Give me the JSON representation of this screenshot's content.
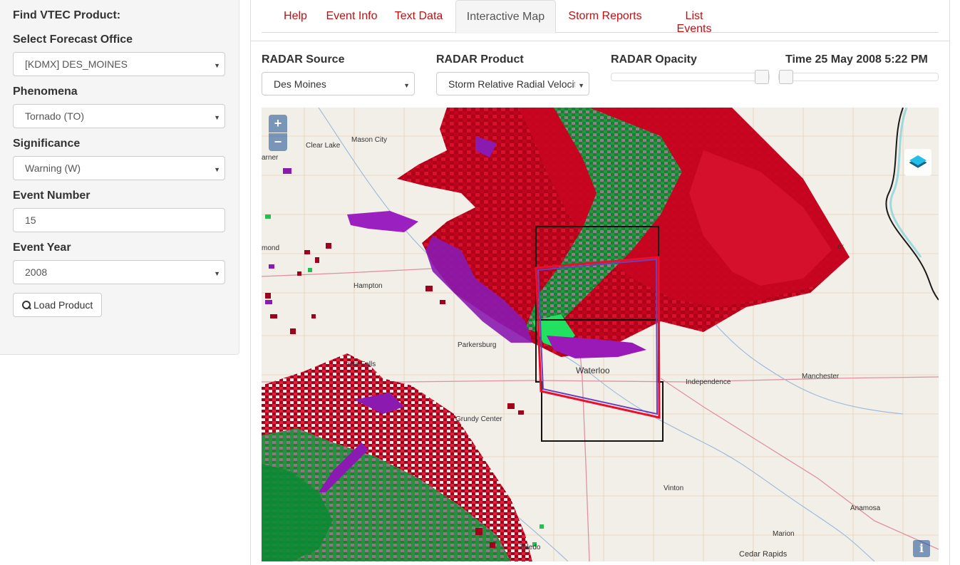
{
  "sidebar": {
    "title": "Find VTEC Product:",
    "office_label": "Select Forecast Office",
    "office_value": "[KDMX] DES_MOINES",
    "phenomena_label": "Phenomena",
    "phenomena_value": "Tornado (TO)",
    "significance_label": "Significance",
    "significance_value": "Warning (W)",
    "event_number_label": "Event Number",
    "event_number_value": "15",
    "event_year_label": "Event Year",
    "event_year_value": "2008",
    "load_button": "Load Product"
  },
  "tabs": [
    {
      "label": "Help",
      "active": false
    },
    {
      "label": "Event Info",
      "active": false
    },
    {
      "label": "Text Data",
      "active": false
    },
    {
      "label": "Interactive Map",
      "active": true
    },
    {
      "label": "Storm Reports",
      "active": false
    },
    {
      "label": "List Events",
      "active": false
    }
  ],
  "controls": {
    "radar_source_label": "RADAR Source",
    "radar_source_value": "Des Moines",
    "radar_product_label": "RADAR Product",
    "radar_product_value": "Storm Relative Radial Velocity",
    "radar_opacity_label": "RADAR Opacity",
    "radar_opacity_level": 1.0,
    "time_label": "Time 25 May 2008 5:22 PM",
    "time_level": 0.0
  },
  "map": {
    "zoom_in": "+",
    "zoom_out": "−",
    "info": "i",
    "layer_icon": "layers-icon",
    "place_labels": {
      "clear_lake": "Clear Lake",
      "mason_city": "Mason City",
      "garner": "arner",
      "richmond": "mond",
      "hampton": "Hampton",
      "parkersburg": "Parkersburg",
      "iowa_falls": "owa Falls",
      "waterloo": "Waterloo",
      "independence": "Independence",
      "manchester": "Manchester",
      "grundy_center": "Grundy Center",
      "vinton": "Vinton",
      "anamosa": "Anamosa",
      "marion": "Marion",
      "cedar_rapids": "Cedar Rapids",
      "toledo": "Toledo",
      "edge_label": "er"
    },
    "colors": {
      "inbound_dark": "#b0001a",
      "inbound": "#e0102a",
      "outbound": "#1aa040",
      "rf": "#8a1ab0",
      "warning_polygon": "#e8102a",
      "county_border": "#111111"
    }
  }
}
